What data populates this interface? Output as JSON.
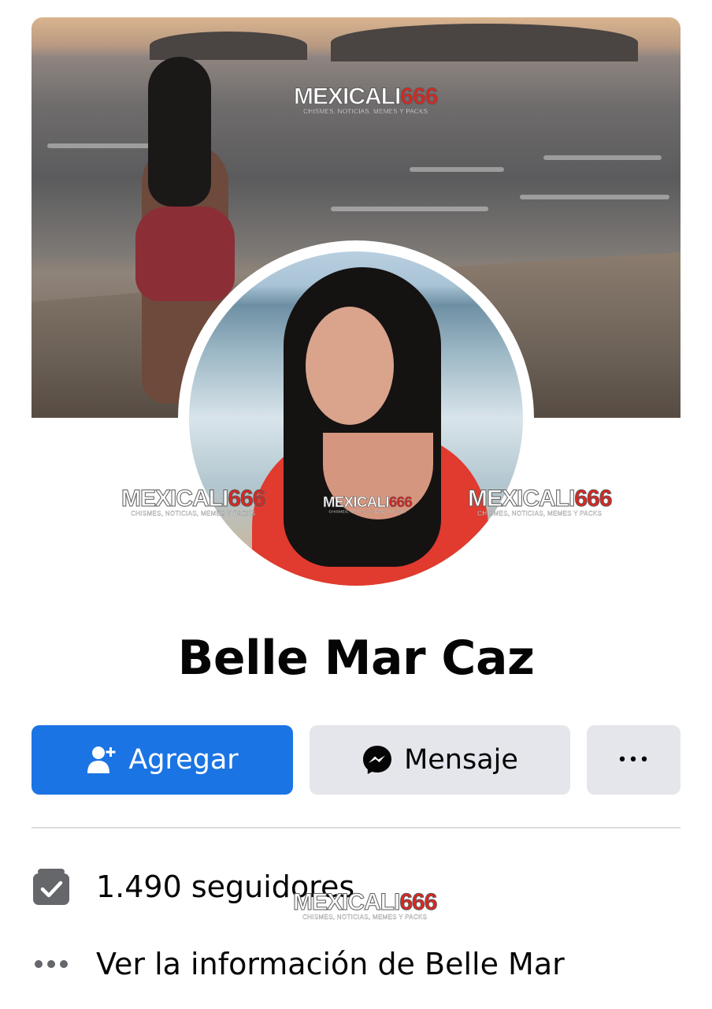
{
  "profile": {
    "name": "Belle Mar Caz"
  },
  "watermark": {
    "brand": "MEXICALI",
    "number": "666",
    "tagline": "CHISMES, NOTICIAS, MEMES Y PACKS"
  },
  "actions": {
    "add_label": "Agregar",
    "message_label": "Mensaje",
    "more_label": "•••"
  },
  "info": {
    "followers_text": "1.490 seguidores",
    "about_text": "Ver la información de Belle Mar"
  },
  "colors": {
    "primary_button": "#1b74e4",
    "secondary_button": "#e4e6eb",
    "text": "#050505",
    "icon_gray": "#65676b"
  },
  "icons": {
    "add": "add-friend-icon",
    "message": "messenger-icon",
    "more": "more-dots-icon",
    "followers": "followers-check-icon",
    "about": "more-info-dots-icon"
  }
}
